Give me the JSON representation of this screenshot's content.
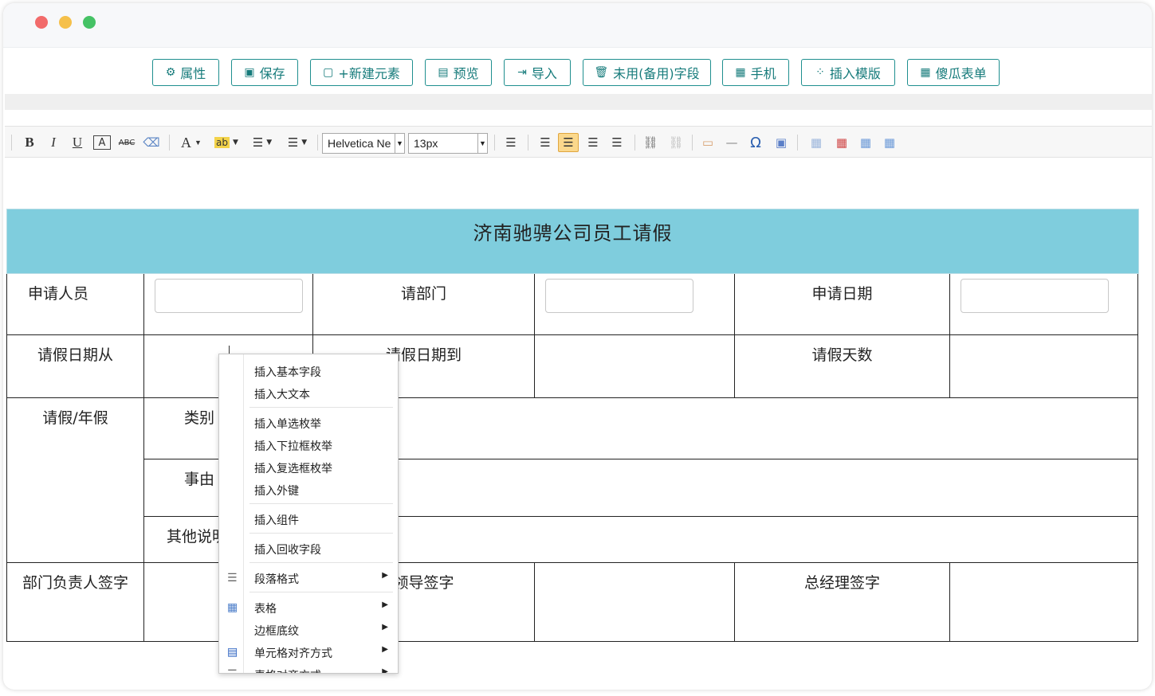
{
  "toolbar_buttons": [
    {
      "label": "属性",
      "icon": "gears-icon",
      "glyph": "⚙"
    },
    {
      "label": "保存",
      "icon": "save-icon",
      "glyph": "▣"
    },
    {
      "label": "+新建元素",
      "icon": "new-file-icon",
      "glyph": "▢"
    },
    {
      "label": "预览",
      "icon": "preview-icon",
      "glyph": "▤"
    },
    {
      "label": "导入",
      "icon": "import-icon",
      "glyph": "⇥"
    },
    {
      "label": "未用(备用)字段",
      "icon": "trash-icon",
      "glyph": "🗑"
    },
    {
      "label": "手机",
      "icon": "mobile-icon",
      "glyph": "▦"
    },
    {
      "label": "插入模版",
      "icon": "template-icon",
      "glyph": "⁘"
    },
    {
      "label": "傻瓜表单",
      "icon": "table-icon",
      "glyph": "▦"
    }
  ],
  "editor": {
    "font_family": "Helvetica Ne",
    "font_size": "13px",
    "bold": "B",
    "italic": "I",
    "underline": "U",
    "font_border": "A",
    "strike": "ABC",
    "font_color": "A",
    "highlight": "ab"
  },
  "form": {
    "title": "济南驰骋公司员工请假",
    "applicant_label": "申请人员",
    "dept_label": "请部门",
    "date_label": "申请日期",
    "from_label": "请假日期从",
    "to_label": "请假日期到",
    "days_label": "请假天数",
    "leave_label": "请假/年假",
    "category_label": "类别",
    "reason_label": "事由",
    "other_label": "其他说明",
    "dept_sign_label": "部门负责人签字",
    "leader_sign_label": "领导签字",
    "gm_sign_label": "总经理签字"
  },
  "context_menu": [
    {
      "label": "插入基本字段"
    },
    {
      "label": "插入大文本"
    },
    {
      "label": "插入单选枚举"
    },
    {
      "label": "插入下拉框枚举"
    },
    {
      "label": "插入复选框枚举"
    },
    {
      "label": "插入外键"
    },
    {
      "label": "插入组件"
    },
    {
      "label": "插入回收字段"
    },
    {
      "label": "段落格式",
      "submenu": true
    },
    {
      "label": "表格",
      "submenu": true
    },
    {
      "label": "边框底纹",
      "submenu": true
    },
    {
      "label": "单元格对齐方式",
      "submenu": true
    },
    {
      "label": "表格对齐方式",
      "submenu": true
    }
  ],
  "colors": {
    "accent": "#167b7b",
    "title_band": "#7fcddd",
    "active_button": "#fbd88c"
  }
}
